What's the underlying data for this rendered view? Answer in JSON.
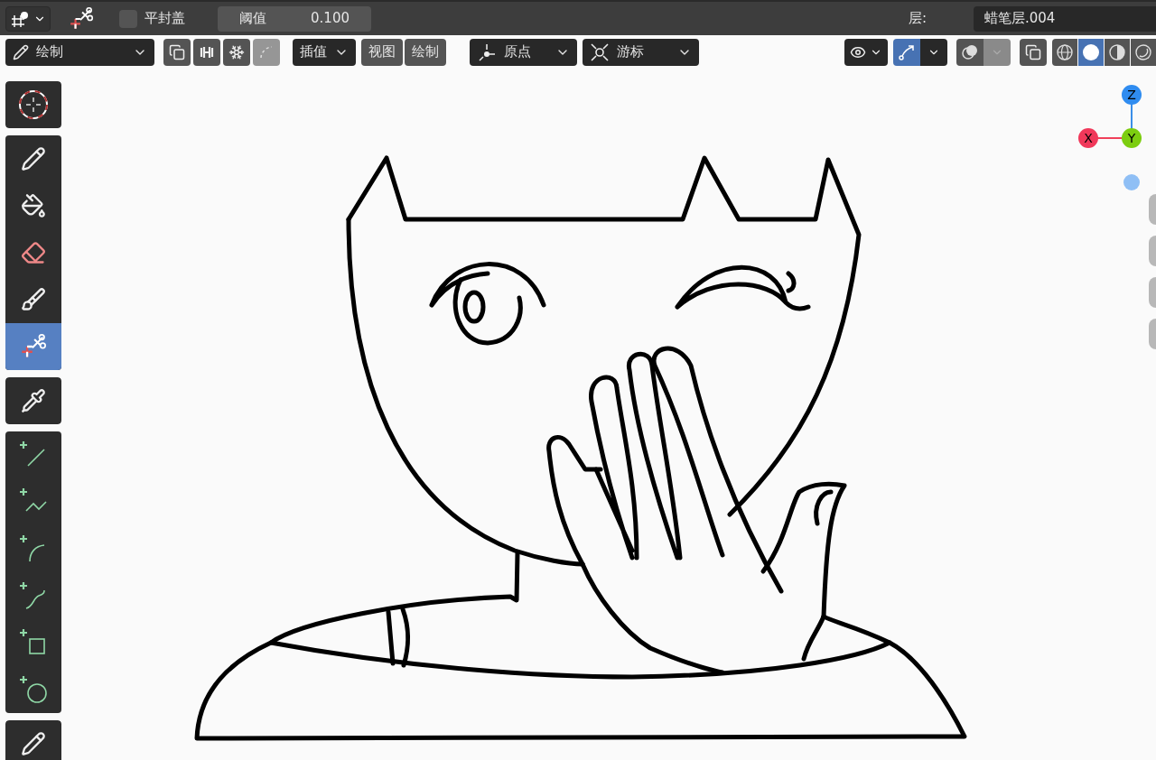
{
  "header": {
    "cap_checkbox": {
      "label": "平封盖",
      "checked": false
    },
    "threshold": {
      "label": "阈值",
      "value": "0.100"
    },
    "layer": {
      "label": "层:",
      "value": "蜡笔层.004"
    }
  },
  "toolbar": {
    "mode": {
      "label": "绘制"
    },
    "interpolation": {
      "label": "插值"
    },
    "menus": [
      {
        "label": "视图"
      },
      {
        "label": "绘制"
      }
    ],
    "pivot": {
      "label": "原点"
    },
    "snap": {
      "label": "游标"
    },
    "edit_lines": {
      "selected": true
    },
    "shading": [
      {
        "kind": "wireframe",
        "selected": false
      },
      {
        "kind": "solid",
        "selected": true
      },
      {
        "kind": "material",
        "selected": false
      },
      {
        "kind": "rendered",
        "selected": false
      }
    ]
  },
  "tool_groups": [
    [
      {
        "kind": "cursor",
        "selected": false
      }
    ],
    [
      {
        "kind": "draw",
        "selected": false
      },
      {
        "kind": "fill",
        "selected": false
      },
      {
        "kind": "erase",
        "selected": false
      },
      {
        "kind": "tint",
        "selected": false
      },
      {
        "kind": "cutter",
        "selected": true
      }
    ],
    [
      {
        "kind": "eyedropper",
        "selected": false
      }
    ],
    [
      {
        "kind": "line",
        "selected": false
      },
      {
        "kind": "polyline",
        "selected": false
      },
      {
        "kind": "arc",
        "selected": false
      },
      {
        "kind": "curve",
        "selected": false
      },
      {
        "kind": "box",
        "selected": false
      },
      {
        "kind": "circle",
        "selected": false
      }
    ],
    [
      {
        "kind": "annotate",
        "selected": false
      }
    ]
  ],
  "gizmo": {
    "z": "Z",
    "x": "X",
    "y": "Y"
  }
}
